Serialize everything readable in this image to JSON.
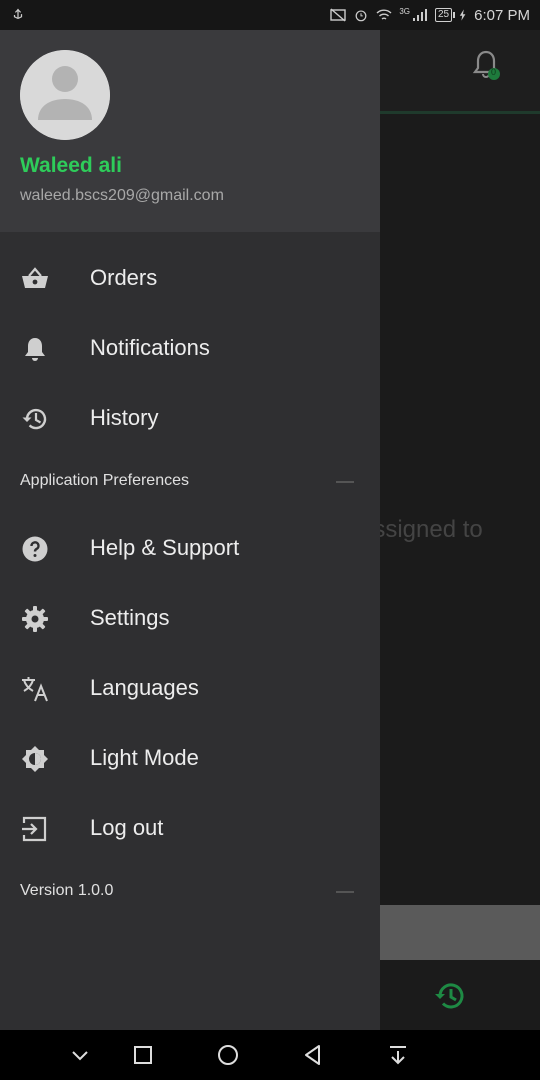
{
  "status_bar": {
    "time": "6:07 PM",
    "battery": "25",
    "network": "3G"
  },
  "background_app": {
    "partial_text": "assigned to",
    "notification_count": "0"
  },
  "drawer": {
    "user": {
      "name": "Waleed ali",
      "email": "waleed.bscs209@gmail.com"
    },
    "items": [
      {
        "label": "Orders",
        "icon": "basket-icon"
      },
      {
        "label": "Notifications",
        "icon": "bell-icon"
      },
      {
        "label": "History",
        "icon": "history-icon"
      }
    ],
    "preferences_title": "Application Preferences",
    "preference_items": [
      {
        "label": "Help & Support",
        "icon": "help-icon"
      },
      {
        "label": "Settings",
        "icon": "gear-icon"
      },
      {
        "label": "Languages",
        "icon": "translate-icon"
      },
      {
        "label": "Light Mode",
        "icon": "brightness-icon"
      },
      {
        "label": "Log out",
        "icon": "logout-icon"
      }
    ],
    "version": "Version 1.0.0"
  },
  "colors": {
    "accent": "#2ecc5a",
    "drawer_bg": "#2f2f31",
    "header_bg": "#3a3a3d"
  }
}
